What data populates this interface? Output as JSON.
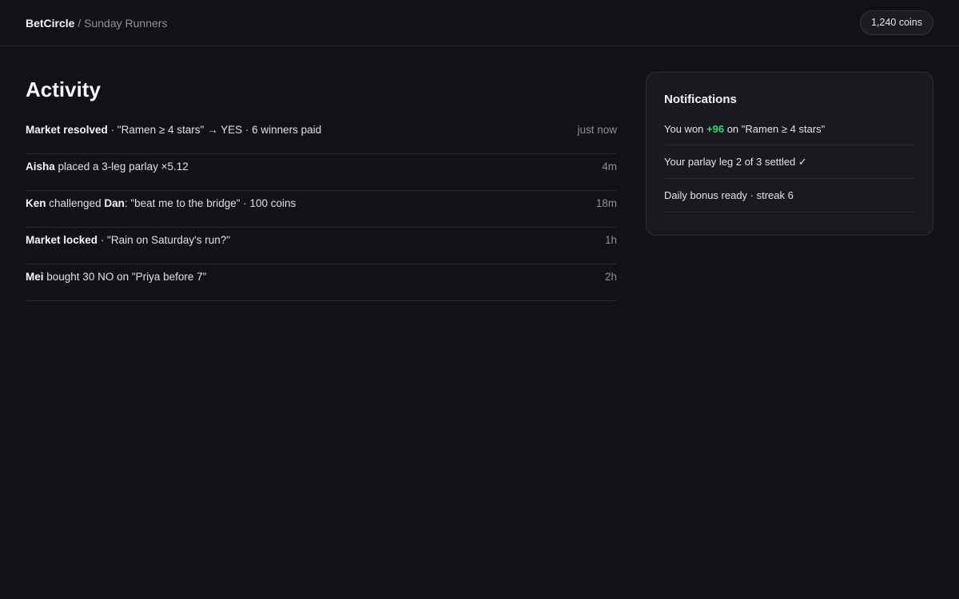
{
  "header": {
    "brand": "BetCircle",
    "separator": " / ",
    "group": "Sunday Runners",
    "coins": "1,240 coins"
  },
  "activity": {
    "title": "Activity",
    "items": [
      {
        "actor": "Market resolved",
        "text": " · \"Ramen ≥ 4 stars\" → YES · 6 winners paid",
        "time": "just now"
      },
      {
        "actor": "Aisha",
        "text": " placed a 3-leg parlay ×5.12",
        "time": "4m"
      },
      {
        "actor": "Ken",
        "text": " challenged ",
        "target": "Dan",
        "text2": ": \"beat me to the bridge\" · 100 coins",
        "time": "18m"
      },
      {
        "actor": "Market locked",
        "text": " · \"Rain on Saturday's run?\"",
        "time": "1h"
      },
      {
        "actor": "Mei",
        "text": " bought 30 NO on \"Priya before 7\"",
        "time": "2h"
      }
    ]
  },
  "notifications": {
    "title": "Notifications",
    "items": [
      {
        "prefix": "You won ",
        "amount": "+96",
        "suffix": " on \"Ramen ≥ 4 stars\""
      },
      {
        "text": "Your parlay leg 2 of 3 settled ✓"
      },
      {
        "text": "Daily bonus ready · streak 6"
      }
    ],
    "colors": {
      "gain": "#37d67a"
    }
  }
}
